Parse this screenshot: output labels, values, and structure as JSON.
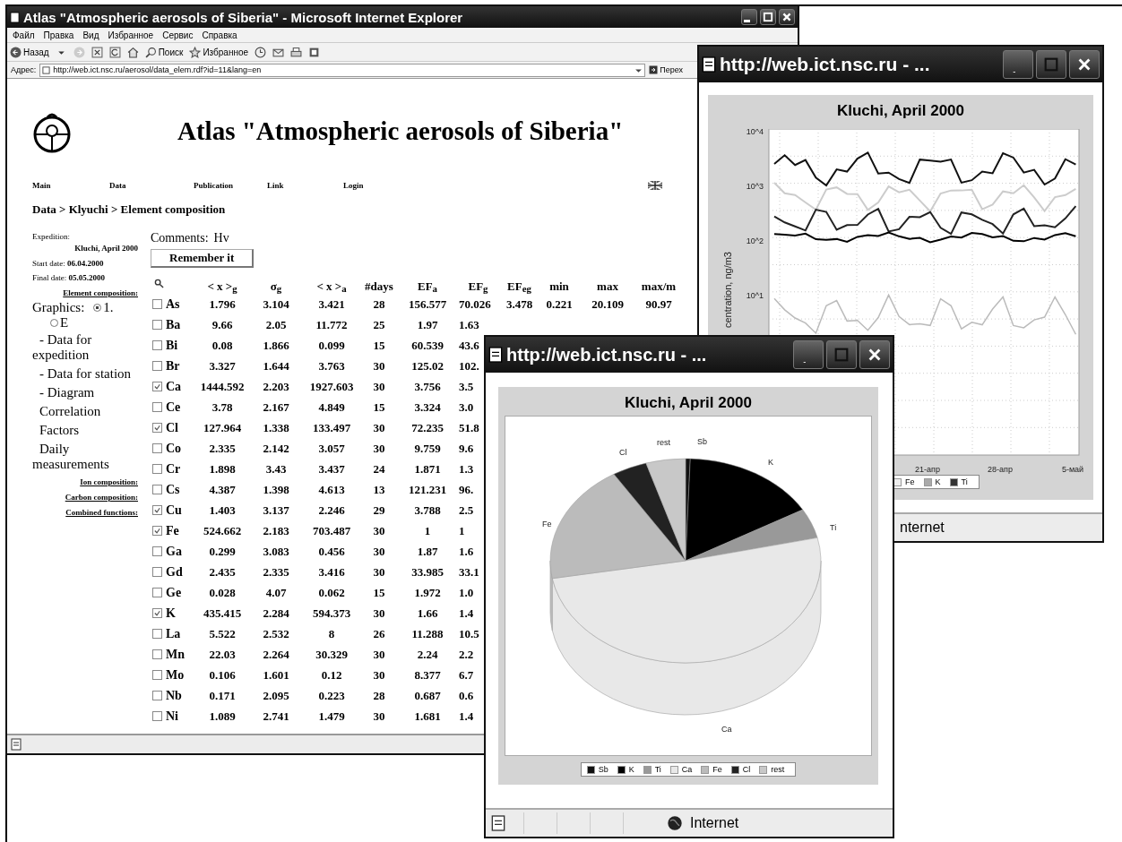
{
  "main_window": {
    "title": "Atlas \"Atmospheric aerosols of Siberia\" - Microsoft Internet Explorer",
    "menu": [
      "Файл",
      "Правка",
      "Вид",
      "Избранное",
      "Сервис",
      "Справка"
    ],
    "toolbar": {
      "back": "Назад",
      "search": "Поиск",
      "favorites": "Избранное"
    },
    "address": {
      "label": "Адрес:",
      "url": "http://web.ict.nsc.ru/aerosol/data_elem.rdf?id=11&lang=en",
      "go": "Перех"
    },
    "page": {
      "heading": "Atlas \"Atmospheric aerosols of Siberia\"",
      "nav": [
        "Main",
        "Data",
        "Publication",
        "Link",
        "Login"
      ],
      "breadcrumb": "Data > Klyuchi > Element composition",
      "sidebar": [
        {
          "kind": "caption",
          "text": "Expedition:"
        },
        {
          "kind": "value",
          "text": "Kluchi, April 2000"
        },
        {
          "kind": "caption",
          "text": "Start date: **06.04.2000**"
        },
        {
          "kind": "caption",
          "text": "Final date: **05.05.2000**"
        },
        {
          "kind": "link",
          "text": "Element composition:"
        },
        {
          "kind": "radios",
          "text": "Graphics:",
          "options": [
            {
              "label": "1.",
              "selected": true
            },
            {
              "label": "E",
              "selected": false
            }
          ]
        },
        {
          "kind": "menu",
          "text": "- Data for expedition"
        },
        {
          "kind": "menu",
          "text": "- Data for station"
        },
        {
          "kind": "menu",
          "text": "- Diagram"
        },
        {
          "kind": "menu",
          "text": "Correlation"
        },
        {
          "kind": "menu",
          "text": "Factors"
        },
        {
          "kind": "menu",
          "text": "Daily measurements"
        },
        {
          "kind": "link",
          "text": "Ion composition:"
        },
        {
          "kind": "link",
          "text": "Carbon composition:"
        },
        {
          "kind": "link",
          "text": "Combined functions:"
        }
      ],
      "comments": {
        "label": "Comments:",
        "value": "Hv"
      },
      "remember_button": "Remember it",
      "columns": [
        "< x >$_{g}$",
        "σ$_{g}$",
        "< x >$_{a}$",
        "#days",
        "EF$_{a}$",
        "EF$_{g}$",
        "EF$_{eg}$",
        "min",
        "max",
        "max/m"
      ],
      "rows": [
        {
          "element": "As",
          "checked": false,
          "cells": [
            "1.796",
            "3.104",
            "3.421",
            "28",
            "156.577",
            "70.026",
            "3.478",
            "0.221",
            "20.109",
            "90.97"
          ]
        },
        {
          "element": "Ba",
          "checked": false,
          "cells": [
            "9.66",
            "2.05",
            "11.772",
            "25",
            "1.97",
            "1.63"
          ]
        },
        {
          "element": "Bi",
          "checked": false,
          "cells": [
            "0.08",
            "1.866",
            "0.099",
            "15",
            "60.539",
            "43.6"
          ]
        },
        {
          "element": "Br",
          "checked": false,
          "cells": [
            "3.327",
            "1.644",
            "3.763",
            "30",
            "125.02",
            "102."
          ]
        },
        {
          "element": "Ca",
          "checked": true,
          "cells": [
            "1444.592",
            "2.203",
            "1927.603",
            "30",
            "3.756",
            "3.5"
          ]
        },
        {
          "element": "Ce",
          "checked": false,
          "cells": [
            "3.78",
            "2.167",
            "4.849",
            "15",
            "3.324",
            "3.0"
          ]
        },
        {
          "element": "Cl",
          "checked": true,
          "cells": [
            "127.964",
            "1.338",
            "133.497",
            "30",
            "72.235",
            "51.8"
          ]
        },
        {
          "element": "Co",
          "checked": false,
          "cells": [
            "2.335",
            "2.142",
            "3.057",
            "30",
            "9.759",
            "9.6"
          ]
        },
        {
          "element": "Cr",
          "checked": false,
          "cells": [
            "1.898",
            "3.43",
            "3.437",
            "24",
            "1.871",
            "1.3"
          ]
        },
        {
          "element": "Cs",
          "checked": false,
          "cells": [
            "4.387",
            "1.398",
            "4.613",
            "13",
            "121.231",
            "96."
          ]
        },
        {
          "element": "Cu",
          "checked": true,
          "cells": [
            "1.403",
            "3.137",
            "2.246",
            "29",
            "3.788",
            "2.5"
          ]
        },
        {
          "element": "Fe",
          "checked": true,
          "cells": [
            "524.662",
            "2.183",
            "703.487",
            "30",
            "1",
            "1"
          ]
        },
        {
          "element": "Ga",
          "checked": false,
          "cells": [
            "0.299",
            "3.083",
            "0.456",
            "30",
            "1.87",
            "1.6"
          ]
        },
        {
          "element": "Gd",
          "checked": false,
          "cells": [
            "2.435",
            "2.335",
            "3.416",
            "30",
            "33.985",
            "33.1"
          ]
        },
        {
          "element": "Ge",
          "checked": false,
          "cells": [
            "0.028",
            "4.07",
            "0.062",
            "15",
            "1.972",
            "1.0"
          ]
        },
        {
          "element": "K",
          "checked": true,
          "cells": [
            "435.415",
            "2.284",
            "594.373",
            "30",
            "1.66",
            "1.4"
          ]
        },
        {
          "element": "La",
          "checked": false,
          "cells": [
            "5.522",
            "2.532",
            "8",
            "26",
            "11.288",
            "10.5"
          ]
        },
        {
          "element": "Mn",
          "checked": false,
          "cells": [
            "22.03",
            "2.264",
            "30.329",
            "30",
            "2.24",
            "2.2"
          ]
        },
        {
          "element": "Mo",
          "checked": false,
          "cells": [
            "0.106",
            "1.601",
            "0.12",
            "30",
            "8.377",
            "6.7"
          ]
        },
        {
          "element": "Nb",
          "checked": false,
          "cells": [
            "0.171",
            "2.095",
            "0.223",
            "28",
            "0.687",
            "0.6"
          ]
        },
        {
          "element": "Ni",
          "checked": false,
          "cells": [
            "1.089",
            "2.741",
            "1.479",
            "30",
            "1.681",
            "1.4"
          ]
        }
      ]
    }
  },
  "line_window": {
    "title": "http://web.ict.nsc.ru - ...",
    "chart_title": "Kluchi, April 2000",
    "y_ticks": [
      "10^4",
      "10^3",
      "10^2",
      "10^1"
    ],
    "y_label": "centration, ng/m3",
    "x_ticks": [
      "21-апр",
      "28-апр",
      "5-май"
    ],
    "legend": [
      {
        "label": "Fe",
        "color": "#eeeeee"
      },
      {
        "label": "K",
        "color": "#aaaaaa"
      },
      {
        "label": "Ti",
        "color": "#333333"
      }
    ],
    "status": "nternet"
  },
  "pie_window": {
    "title": "http://web.ict.nsc.ru - ...",
    "chart_title": "Kluchi, April 2000",
    "slice_labels": [
      "Sb",
      "K",
      "Ti",
      "Ca",
      "Fe",
      "Cl",
      "rest"
    ],
    "legend": [
      {
        "label": "Sb",
        "color": "#111111"
      },
      {
        "label": "K",
        "color": "#000000"
      },
      {
        "label": "Ti",
        "color": "#999999"
      },
      {
        "label": "Ca",
        "color": "#e8e8e8"
      },
      {
        "label": "Fe",
        "color": "#bbbbbb"
      },
      {
        "label": "Cl",
        "color": "#222222"
      },
      {
        "label": "rest",
        "color": "#c8c8c8"
      }
    ],
    "status": "Internet"
  }
}
